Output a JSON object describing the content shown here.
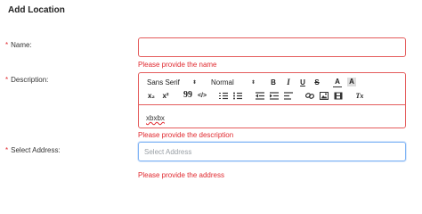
{
  "form": {
    "title": "Add Location",
    "required_marker": "*",
    "name": {
      "label": "Name:",
      "value": "",
      "placeholder": "",
      "error": "Please provide the name"
    },
    "description": {
      "label": "Description:",
      "content": "xbxbx",
      "error": "Please provide the description",
      "toolbar": {
        "font_select": "Sans Serif",
        "size_select": "Normal",
        "bold": "B",
        "italic": "I",
        "underline": "U",
        "strike": "S",
        "color": "A",
        "background": "A",
        "subscript": "x₂",
        "superscript": "x²",
        "blockquote": "99",
        "code": "</>",
        "clean": "Tx",
        "icons": [
          "ordered-list-icon",
          "bullet-list-icon",
          "outdent-icon",
          "indent-icon",
          "align-icon",
          "link-icon",
          "image-icon",
          "video-icon"
        ]
      }
    },
    "address": {
      "label": "Select Address:",
      "value": "",
      "placeholder": "Select Address",
      "error": "Please provide the address"
    }
  },
  "colors": {
    "error": "#e0282e",
    "error_border": "#e45c5c",
    "focus_border": "#7eb3f5"
  }
}
